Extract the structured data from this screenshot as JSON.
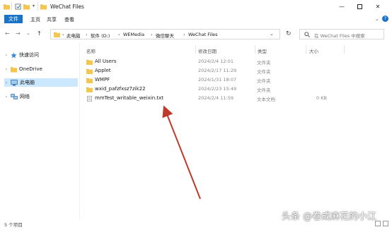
{
  "window": {
    "title": "WeChat Files"
  },
  "ribbon": {
    "tabs": [
      "文件",
      "主页",
      "共享",
      "查看"
    ]
  },
  "nav_buttons": {
    "back": "←",
    "forward": "→",
    "recent": "⌄",
    "up": "↑"
  },
  "address": {
    "crumbs": [
      "此电脑",
      "软件 (D:)",
      "WEMedia",
      "微信聊天",
      "WeChat Files"
    ]
  },
  "search": {
    "placeholder": "在 WeChat Files 中搜索"
  },
  "nav_pane": {
    "items": [
      {
        "label": "快速访问"
      },
      {
        "label": "OneDrive"
      },
      {
        "label": "此电脑"
      },
      {
        "label": "网络"
      }
    ]
  },
  "columns": {
    "name": "名称",
    "date": "修改日期",
    "type": "类型",
    "size": "大小"
  },
  "files": [
    {
      "name": "All Users",
      "date": "2024/2/4 12:01",
      "type": "文件夹",
      "size": "",
      "kind": "folder"
    },
    {
      "name": "Applet",
      "date": "2024/2/17 11:29",
      "type": "文件夹",
      "size": "",
      "kind": "folder"
    },
    {
      "name": "WMPF",
      "date": "2024/1/31 18:07",
      "type": "文件夹",
      "size": "",
      "kind": "folder"
    },
    {
      "name": "wxid_pafzfxsz7zik22",
      "date": "2024/2/23 15:49",
      "type": "文件夹",
      "size": "",
      "kind": "folder"
    },
    {
      "name": "mmTest_writable_weixin.txt",
      "date": "2024/2/4 11:59",
      "type": "文本文档",
      "size": "0 KB",
      "kind": "txt"
    }
  ],
  "status": {
    "count": "5 个项目"
  },
  "watermark": {
    "text": "头条 @卷成麻花的小江"
  },
  "colors": {
    "accent": "#1a73c8",
    "folder": "#f4c64e",
    "arrow": "#c0392b",
    "selection": "#cce8ff"
  }
}
